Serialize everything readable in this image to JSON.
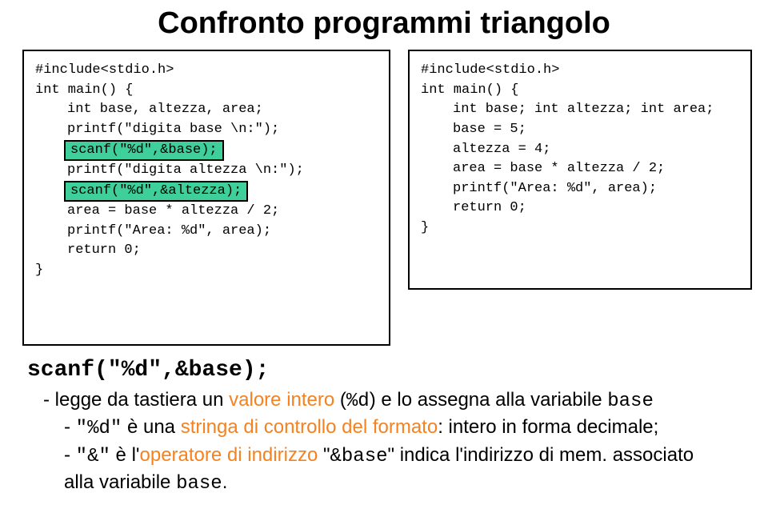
{
  "title": "Confronto programmi triangolo",
  "left": {
    "l0": "#include<stdio.h>",
    "l1": "int main() {",
    "l2": "int base, altezza, area;",
    "l3": "",
    "l4": "printf(\"digita base \\n:\");",
    "hl1": "scanf(\"%d\",&base);",
    "l5": "printf(\"digita altezza \\n:\");",
    "hl2": "scanf(\"%d\",&altezza);",
    "l6": "",
    "l7": "area = base * altezza / 2;",
    "l8": "",
    "l9": "printf(\"Area: %d\", area);",
    "l10": "return 0;",
    "l11": "}"
  },
  "right": {
    "r0": "#include<stdio.h>",
    "r1": "int main() {",
    "r2": "int base; int altezza; int area;",
    "r3": "",
    "r4": "base = 5;",
    "r5": "altezza = 4;",
    "r6": "",
    "r7": "area = base * altezza / 2;",
    "r8": "",
    "r9": "printf(\"Area: %d\", area);",
    "r10": "return 0;",
    "r11": "}"
  },
  "explain": {
    "head": "scanf(\"%d\",&base);",
    "line1_a": "- legge da tastiera un ",
    "line1_b": "valore intero",
    "line1_c": " (",
    "line1_d": "%d",
    "line1_e": ") e lo assegna alla variabile ",
    "line1_f": "base",
    "line2_a": "- ",
    "line2_b": "\"%d\"",
    "line2_c": " è una ",
    "line2_d": "stringa di controllo del formato",
    "line2_e": ": intero in forma decimale;",
    "line3_a": "- ",
    "line3_b": "\"&\"",
    "line3_c": " è l'",
    "line3_d": "operatore di indirizzo",
    "line3_e": " \"",
    "line3_f": "&base",
    "line3_g": "\" indica l'indirizzo di mem. associato",
    "line4_a": "alla variabile ",
    "line4_b": "base",
    "line4_c": "."
  }
}
